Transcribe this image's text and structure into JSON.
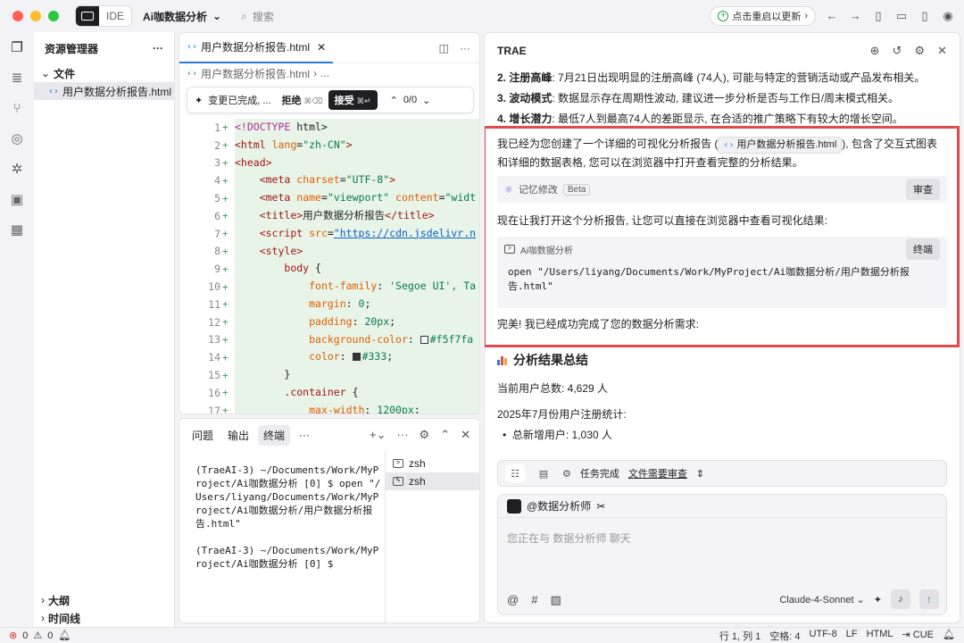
{
  "titlebar": {
    "ide_label": "IDE",
    "project": "Ai咖数据分析",
    "search": "搜索",
    "update": "点击重启以更新"
  },
  "explorer": {
    "title": "资源管理器",
    "folder": "文件",
    "file": "用户数据分析报告.html",
    "outline": "大纲",
    "timeline": "时间线"
  },
  "editor": {
    "tab": "用户数据分析报告.html",
    "breadcrumb": "用户数据分析报告.html",
    "breadcrumb_more": "...",
    "diff_status": "变更已完成, ...",
    "reject": "拒绝",
    "reject_key": "⌘⌫",
    "accept": "接受",
    "accept_key": "⌘↵",
    "diff_count": "0/0",
    "lines": [
      "1",
      "2",
      "3",
      "4",
      "5",
      "6",
      "7",
      "8",
      "9",
      "10",
      "11",
      "12",
      "13",
      "14",
      "15",
      "16",
      "17"
    ]
  },
  "terminal": {
    "tabs": [
      "问题",
      "输出",
      "终端",
      "···"
    ],
    "output": "(TraeAI-3) ~/Documents/Work/MyProject/Ai咖数据分析 [0] $ open \"/Users/liyang/Documents/Work/MyProject/Ai咖数据分析/用户数据分析报告.html\"\n\n(TraeAI-3) ~/Documents/Work/MyProject/Ai咖数据分析 [0] $",
    "sessions": [
      "zsh",
      "zsh"
    ]
  },
  "chat": {
    "title": "TRAE",
    "items": [
      {
        "num": "2.",
        "head": "注册高峰",
        "text": ": 7月21日出现明显的注册高峰 (74人), 可能与特定的营销活动或产品发布相关。"
      },
      {
        "num": "3.",
        "head": "波动模式",
        "text": ": 数据显示存在周期性波动, 建议进一步分析是否与工作日/周末模式相关。"
      },
      {
        "num": "4.",
        "head": "增长潜力",
        "text": ": 最低7人到最高74人的差距显示, 在合适的推广策略下有较大的增长空间。"
      }
    ],
    "msg1_a": "我已经为您创建了一个详细的可视化分析报告 (",
    "msg1_file": "用户数据分析报告.html",
    "msg1_b": "), 包含了交互式图表和详细的数据表格, 您可以在浏览器中打开查看完整的分析结果。",
    "memory": "记忆修改",
    "beta": "Beta",
    "review": "审查",
    "msg2": "现在让我打开这个分析报告, 让您可以直接在浏览器中查看可视化结果:",
    "cmd_label": "Ai咖数据分析",
    "terminal_btn": "终端",
    "cmd": "open \"/Users/liyang/Documents/Work/MyProject/Ai咖数据分析/用户数据分析报告.html\"",
    "msg3": "完美! 我已经成功完成了您的数据分析需求:",
    "summary_title": "分析结果总结",
    "users_total": "当前用户总数: 4,629 人",
    "july_stats": "2025年7月份用户注册统计:",
    "new_users": "总新增用户: 1,030 人",
    "task_done": "任务完成",
    "task_review": "文件需要审查",
    "agent": "@数据分析师",
    "placeholder": "您正在与 数据分析师 聊天",
    "model": "Claude-4-Sonnet"
  },
  "status": {
    "errors": "0",
    "warnings": "0",
    "position": "行 1, 列 1",
    "spaces": "空格: 4",
    "encoding": "UTF-8",
    "eol": "LF",
    "lang": "HTML",
    "cue": "CUE"
  }
}
